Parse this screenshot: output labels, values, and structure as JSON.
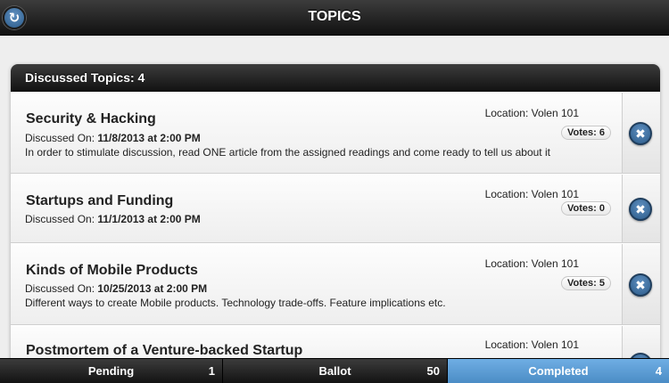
{
  "header": {
    "title": "TOPICS",
    "refresh_icon": "refresh-icon"
  },
  "list": {
    "divider": "Discussed Topics: 4",
    "items": [
      {
        "title": "Security & Hacking",
        "discussed_prefix": "Discussed On:",
        "discussed_date": "11/8/2013 at 2:00 PM",
        "description": "In order to stimulate discussion, read ONE article from the assigned readings and come ready to tell us about it",
        "location": "Location: Volen 101",
        "votes": "Votes: 6"
      },
      {
        "title": "Startups and Funding",
        "discussed_prefix": "Discussed On:",
        "discussed_date": "11/1/2013 at 2:00 PM",
        "description": "",
        "location": "Location: Volen 101",
        "votes": "Votes: 0"
      },
      {
        "title": "Kinds of Mobile Products",
        "discussed_prefix": "Discussed On:",
        "discussed_date": "10/25/2013 at 2:00 PM",
        "description": "Different ways to create Mobile products. Technology trade-offs. Feature implications etc.",
        "location": "Location: Volen 101",
        "votes": "Votes: 5"
      },
      {
        "title": "Postmortem of a Venture-backed Startup",
        "location": "Location: Volen 101"
      }
    ]
  },
  "footer": {
    "tabs": [
      {
        "label": "Pending",
        "count": "1"
      },
      {
        "label": "Ballot",
        "count": "50"
      },
      {
        "label": "Completed",
        "count": "4",
        "active": true
      }
    ]
  },
  "colors": {
    "bar_dark": "#111111",
    "accent_blue": "#4a8bc4",
    "button_blue": "#2b5b8a"
  }
}
